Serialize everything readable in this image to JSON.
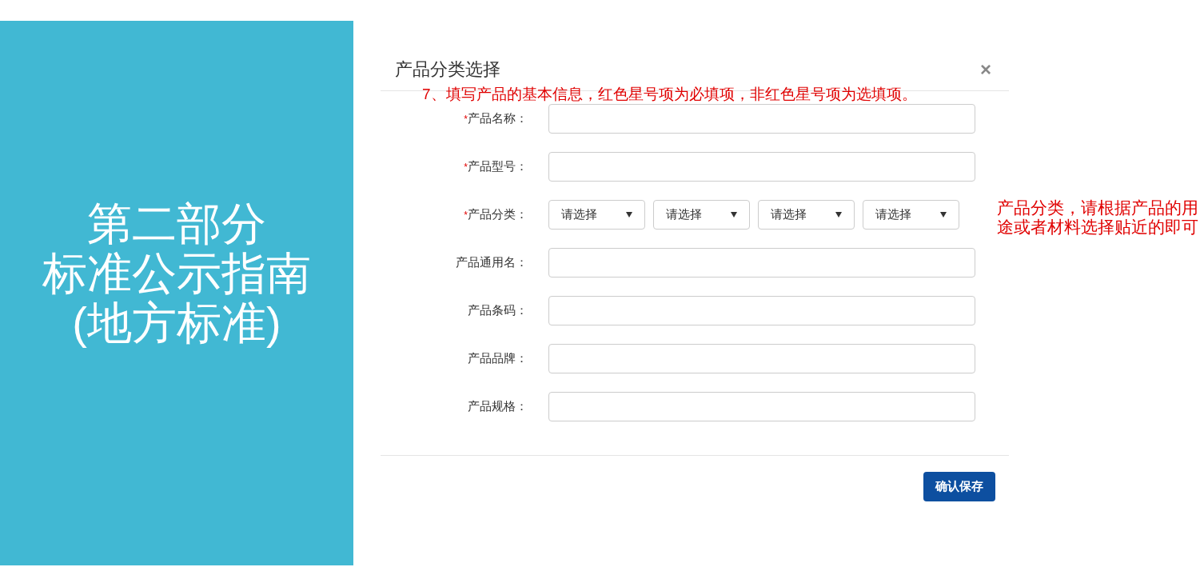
{
  "slide_title": [
    "第二部分",
    "标准公示指南",
    "(地方标准)"
  ],
  "dialog": {
    "title": "产品分类选择",
    "close": "×",
    "instruction": "7、填写产品的基本信息，红色星号项为必填项，非红色星号项为选填项。",
    "fields": [
      {
        "kind": "text",
        "label": "产品名称：",
        "required": true
      },
      {
        "kind": "text",
        "label": "产品型号：",
        "required": true
      },
      {
        "kind": "selects",
        "label": "产品分类：",
        "required": true,
        "options": [
          "请选择",
          "请选择",
          "请选择",
          "请选择"
        ]
      },
      {
        "kind": "text",
        "label": "产品通用名：",
        "required": false
      },
      {
        "kind": "text",
        "label": "产品条码：",
        "required": false
      },
      {
        "kind": "text",
        "label": "产品品牌：",
        "required": false
      },
      {
        "kind": "text",
        "label": "产品规格：",
        "required": false
      }
    ],
    "side_note": "产品分类，请根据产品的用途或者材料选择贴近的即可",
    "save_button": "确认保存",
    "required_mark": "*"
  }
}
